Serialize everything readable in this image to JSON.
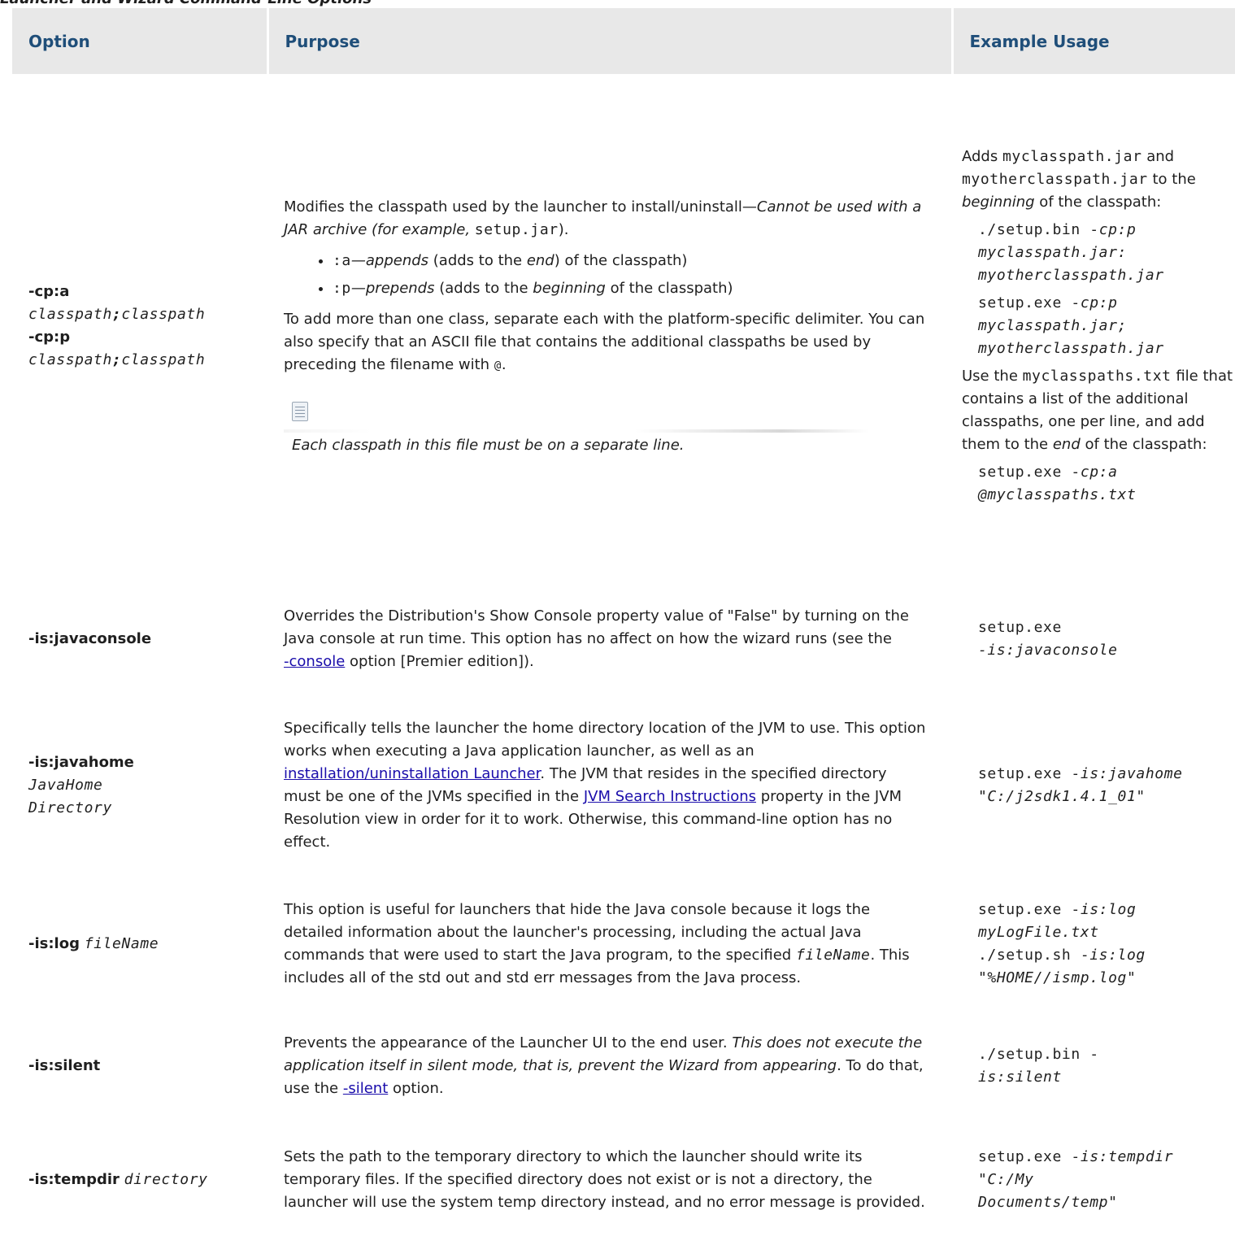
{
  "caption": "Launcher and Wizard Command-Line Options",
  "table": {
    "headers": {
      "option": "Option",
      "purpose": "Purpose",
      "example": "Example Usage"
    },
    "rows": {
      "cp": {
        "opt_a": "-cp:a",
        "opt_p": "-cp:p",
        "arg_classpath": "classpath",
        "arg_sep": ";",
        "purpose_1": "Modifies the classpath used by the launcher to install/uninstall—",
        "purpose_1_it": "Cannot be used with a JAR archive (for example, ",
        "purpose_1_code": "setup.jar",
        "purpose_1_end": ").",
        "li_a_code": ":a",
        "li_a_em": "—appends",
        "li_a_text1": " (adds to the ",
        "li_a_em2": "end",
        "li_a_text2": ") of the classpath)",
        "li_p_code": ":p",
        "li_p_em": "—prepends",
        "li_p_text1": " (adds to the ",
        "li_p_em2": "beginning",
        "li_p_text2": " of the classpath)",
        "purpose_2": "To add more than one class, separate each with the platform-specific delimiter. You can also specify that an ASCII file that contains the additional classpaths be used by preceding the filename with ",
        "purpose_2_code": "@",
        "purpose_2_end": ".",
        "note": "Each classpath in this file must be on a separate line.",
        "ex_1a": "Adds ",
        "ex_1_code1": "myclasspath.jar",
        "ex_1b": " and ",
        "ex_1_code2": "myotherclasspath.jar",
        "ex_1c": " to the ",
        "ex_1_em": "beginning",
        "ex_1d": " of the classpath:",
        "ex_cmd1_a": "./setup.bin -",
        "ex_cmd1_b": "cp:p myclasspath.jar: myotherclasspath.jar",
        "ex_cmd2_a": "setup.exe -",
        "ex_cmd2_b": "cp:p myclasspath.jar; myotherclasspath.jar",
        "ex_2a": "Use the ",
        "ex_2_code": "myclasspaths.txt",
        "ex_2b": " file that contains a list of the additional classpaths, one per line, and add them to the ",
        "ex_2_em": "end",
        "ex_2c": " of the classpath:",
        "ex_cmd3_a": "setup.exe -",
        "ex_cmd3_b": "cp:a @myclasspaths.txt"
      },
      "javaconsole": {
        "opt": "-is:javaconsole",
        "purpose_a": "Overrides the Distribution's Show Console property value of \"False\" by turning on the Java console at run time. This option has no affect on how the wizard runs (see the",
        "link": "-console",
        "purpose_b": " option [Premier edition]).",
        "ex_a": "setup.exe",
        "ex_b": "-is:javaconsole"
      },
      "javahome": {
        "opt": "-is:javahome",
        "arg": "JavaHome Directory",
        "purpose_a": "Specifically tells the launcher the home directory location of the JVM to use. This option works when executing a Java application launcher, as well as an ",
        "link1": "installation/uninstallation Launcher",
        "purpose_b": ". The JVM that resides in the specified directory must be one of the JVMs specified in the ",
        "link2": "JVM Search Instructions",
        "purpose_c": " property in the JVM Resolution view in order for it to work. Otherwise, this command-line option has no effect.",
        "ex_a": "setup.exe -",
        "ex_b": "is:javahome \"C:/j2sdk1.4.1_01\""
      },
      "log": {
        "opt": "-is:log",
        "arg": "fileName",
        "purpose_a": "This option is useful for launchers that hide the Java console because it logs the detailed information about the launcher's processing, including the actual Java commands that were used to start the Java program, to the specified ",
        "purpose_code": "fileName",
        "purpose_b": ". This includes all of the std out and std err messages from the Java process.",
        "ex_a": "setup.exe -",
        "ex_b": "is:log myLogFile.txt",
        "ex_c": "./setup.sh -",
        "ex_d": "is:log \"%HOME//ismp.log\""
      },
      "silent": {
        "opt": "-is:silent",
        "purpose_a": "Prevents the appearance of the Launcher UI to the end user. ",
        "purpose_it": "This does not execute the application itself in silent mode, that is, prevent the Wizard from appearing",
        "purpose_b": ". To do that, use the ",
        "link": "-silent",
        "purpose_c": " option.",
        "ex_a": "./setup.bin -",
        "ex_b": "is:silent"
      },
      "tempdir": {
        "opt": "-is:tempdir",
        "arg": "directory",
        "purpose": "Sets the path to the temporary directory to which the launcher should write its temporary files. If the specified directory does not exist or is not a directory, the launcher will use the system temp directory instead, and no error message is provided.",
        "ex_a": "setup.exe -",
        "ex_b": "is:tempdir \"C:/My Documents/temp\""
      }
    }
  }
}
